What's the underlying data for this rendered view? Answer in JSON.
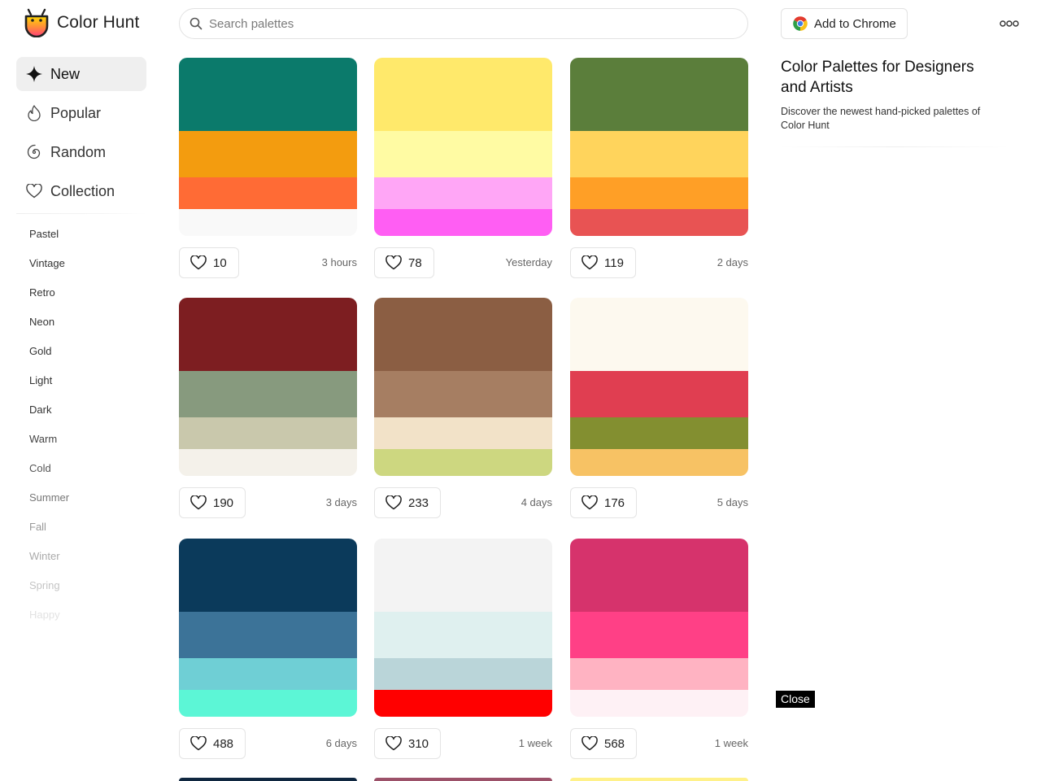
{
  "header": {
    "brand": "Color Hunt",
    "search_placeholder": "Search palettes",
    "chrome_button": "Add to Chrome"
  },
  "nav": {
    "items": [
      {
        "label": "New",
        "icon": "sparkle-icon",
        "active": true
      },
      {
        "label": "Popular",
        "icon": "flame-icon",
        "active": false
      },
      {
        "label": "Random",
        "icon": "spiral-icon",
        "active": false
      },
      {
        "label": "Collection",
        "icon": "heart-icon",
        "active": false
      }
    ],
    "tags": [
      "Pastel",
      "Vintage",
      "Retro",
      "Neon",
      "Gold",
      "Light",
      "Dark",
      "Warm",
      "Cold",
      "Summer",
      "Fall",
      "Winter",
      "Spring",
      "Happy"
    ],
    "tag_colors": [
      "#333333",
      "#333333",
      "#333333",
      "#333333",
      "#333333",
      "#333333",
      "#333333",
      "#444444",
      "#555555",
      "#777777",
      "#999999",
      "#aaaaaa",
      "#c4c4c4",
      "#e2e2e2"
    ]
  },
  "palettes": [
    {
      "colors": [
        "#0b7a6b",
        "#f39c0f",
        "#ff6b35",
        "#f9f9f9"
      ],
      "likes": "10",
      "time": "3 hours"
    },
    {
      "colors": [
        "#ffe96b",
        "#fffba3",
        "#ffa6f6",
        "#ff5ef3"
      ],
      "likes": "78",
      "time": "Yesterday"
    },
    {
      "colors": [
        "#5b7e3b",
        "#ffd45c",
        "#ff9f26",
        "#e85353"
      ],
      "likes": "119",
      "time": "2 days"
    },
    {
      "colors": [
        "#7d1e21",
        "#879a7e",
        "#c9c8ac",
        "#f4f1ea"
      ],
      "likes": "190",
      "time": "3 days"
    },
    {
      "colors": [
        "#8b5e43",
        "#a67e62",
        "#f2e2c8",
        "#cdd780"
      ],
      "likes": "233",
      "time": "4 days"
    },
    {
      "colors": [
        "#fdf9ef",
        "#e03e51",
        "#838f30",
        "#f7c264"
      ],
      "likes": "176",
      "time": "5 days"
    },
    {
      "colors": [
        "#0b3a5b",
        "#3c7398",
        "#6fcfd5",
        "#5cf6d6"
      ],
      "likes": "488",
      "time": "6 days"
    },
    {
      "colors": [
        "#f3f3f3",
        "#dff0ef",
        "#bad5d9",
        "#ff0000"
      ],
      "likes": "310",
      "time": "1 week"
    },
    {
      "colors": [
        "#d6336c",
        "#ff4086",
        "#ffb3c2",
        "#fef1f5"
      ],
      "likes": "568",
      "time": "1 week"
    }
  ],
  "peek_colors": [
    "#0f2740",
    "#9c5169",
    "#fff18a"
  ],
  "panel": {
    "title": "Color Palettes for Designers and Artists",
    "description": "Discover the newest hand-picked palettes of Color Hunt",
    "close_label": "Close"
  }
}
